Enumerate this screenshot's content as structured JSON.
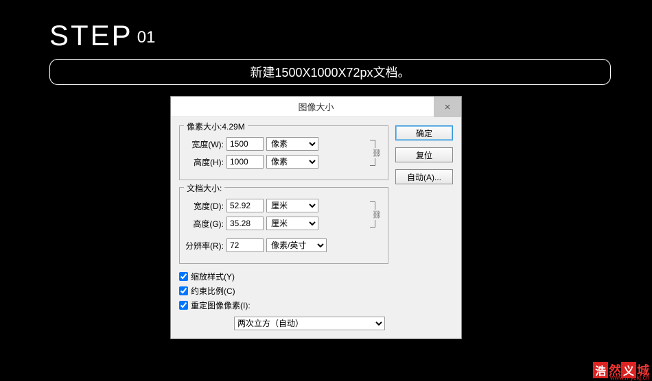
{
  "step": {
    "prefix": "STEP",
    "number": "01"
  },
  "instruction": "新建1500X1000X72px文档。",
  "dialog": {
    "title": "图像大小",
    "close": "×",
    "pixel_size": {
      "legend": "像素大小:4.29M",
      "width_label": "宽度(W):",
      "width_value": "1500",
      "width_unit": "像素",
      "height_label": "高度(H):",
      "height_value": "1000",
      "height_unit": "像素"
    },
    "doc_size": {
      "legend": "文档大小:",
      "width_label": "宽度(D):",
      "width_value": "52.92",
      "width_unit": "厘米",
      "height_label": "高度(G):",
      "height_value": "35.28",
      "height_unit": "厘米",
      "res_label": "分辨率(R):",
      "res_value": "72",
      "res_unit": "像素/英寸"
    },
    "checkboxes": {
      "scale_styles": "缩放样式(Y)",
      "constrain": "约束比例(C)",
      "resample": "重定图像像素(I):"
    },
    "resample_method": "两次立方（自动）",
    "buttons": {
      "ok": "确定",
      "cancel": "复位",
      "auto": "自动(A)..."
    }
  },
  "watermark": {
    "chars": [
      "浩",
      "然",
      "义",
      "城"
    ],
    "url": "www.hryckj.cn"
  },
  "link_icon": "⛓"
}
